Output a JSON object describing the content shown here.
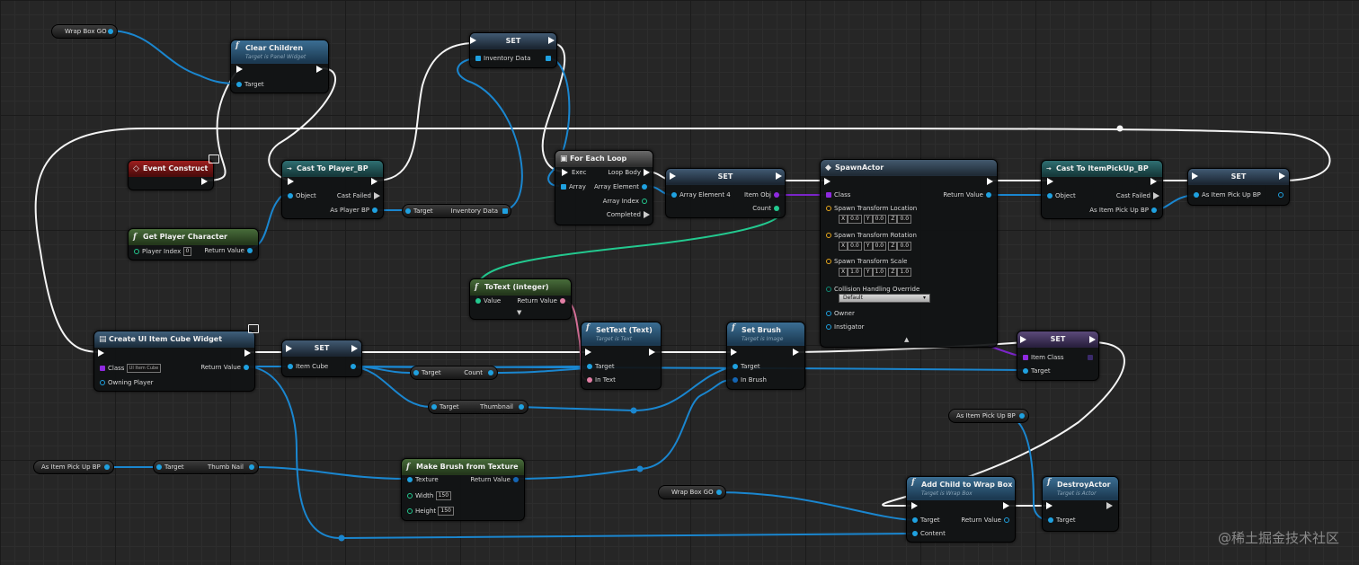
{
  "colors": {
    "exec": "#ffffff",
    "object": "#1fa1e0",
    "integer": "#1fdc9a",
    "text": "#e37fa6",
    "class": "#8f2ae0",
    "struct": "#e8a81c"
  },
  "nodes": {
    "wrap_box_var_top": {
      "label": "Wrap Box GO"
    },
    "clear_children": {
      "title": "Clear Children",
      "subtitle": "Target is Panel Widget",
      "target": "Target"
    },
    "set_inventory": {
      "title": "SET",
      "pin": "Inventory Data"
    },
    "event_construct": {
      "title": "Event Construct"
    },
    "cast_player": {
      "title": "Cast To Player_BP",
      "object": "Object",
      "cast_failed": "Cast Failed",
      "as_player": "As Player BP"
    },
    "get_inventory": {
      "target": "Target",
      "output": "Inventory Data"
    },
    "get_player_character": {
      "title": "Get Player Character",
      "player_index": "Player Index",
      "player_index_value": "0",
      "return_value": "Return Value"
    },
    "for_each_loop": {
      "title": "For Each Loop",
      "exec": "Exec",
      "loop_body": "Loop Body",
      "array": "Array",
      "array_element": "Array Element",
      "array_index": "Array Index",
      "completed": "Completed"
    },
    "break_set": {
      "title": "SET",
      "element": "Array Element 4",
      "item_obj": "Item Obj",
      "count": "Count"
    },
    "spawn_actor": {
      "title": "SpawnActor",
      "class": "Class",
      "return_value": "Return Value",
      "location": "Spawn Transform Location",
      "rotation": "Spawn Transform Rotation",
      "scale": "Spawn Transform Scale",
      "loc_vals": [
        "0.0",
        "0.0",
        "0.0"
      ],
      "rot_vals": [
        "0.0",
        "0.0",
        "0.0"
      ],
      "scale_vals": [
        "1.0",
        "1.0",
        "1.0"
      ],
      "axes": [
        "X",
        "Y",
        "Z"
      ],
      "collision": "Collision Handling Override",
      "collision_value": "Default",
      "owner": "Owner",
      "instigator": "Instigator"
    },
    "cast_item": {
      "title": "Cast To ItemPickUp_BP",
      "object": "Object",
      "cast_failed": "Cast Failed",
      "as_item": "As Item Pick Up BP"
    },
    "set_item_pickup": {
      "title": "SET",
      "pin": "As Item Pick Up BP"
    },
    "to_text": {
      "title": "ToText (integer)",
      "value": "Value",
      "return_value": "Return Value"
    },
    "create_widget": {
      "title": "Create UI Item Cube Widget",
      "class": "Class",
      "class_value": "UI Item Cube",
      "return_value": "Return Value",
      "owning_player": "Owning Player"
    },
    "set_item_cube": {
      "title": "SET",
      "pin": "Item Cube"
    },
    "get_count": {
      "target": "Target",
      "output": "Count"
    },
    "get_thumbnail": {
      "target": "Target",
      "output": "Thumbnail"
    },
    "set_text": {
      "title": "SetText (Text)",
      "subtitle": "Target is Text",
      "target": "Target",
      "in_text": "In Text"
    },
    "set_brush": {
      "title": "Set Brush",
      "subtitle": "Target is Image",
      "target": "Target",
      "in_brush": "In Brush"
    },
    "set_item_class": {
      "title": "SET",
      "item_class": "Item Class",
      "target": "Target"
    },
    "as_item_pickup_var_right": {
      "label": "As Item Pick Up BP"
    },
    "as_item_pickup_var_left": {
      "label": "As Item Pick Up BP"
    },
    "get_thumb_nail": {
      "target": "Target",
      "output": "Thumb Nail"
    },
    "make_brush": {
      "title": "Make Brush from Texture",
      "texture": "Texture",
      "return_value": "Return Value",
      "width": "Width",
      "width_value": "150",
      "height": "Height",
      "height_value": "150"
    },
    "wrap_box_var_bottom": {
      "label": "Wrap Box GO"
    },
    "add_child": {
      "title": "Add Child to Wrap Box",
      "subtitle": "Target is Wrap Box",
      "target": "Target",
      "return_value": "Return Value",
      "content": "Content"
    },
    "destroy_actor": {
      "title": "DestroyActor",
      "subtitle": "Target is Actor",
      "target": "Target"
    }
  },
  "watermark": "@稀土掘金技术社区"
}
